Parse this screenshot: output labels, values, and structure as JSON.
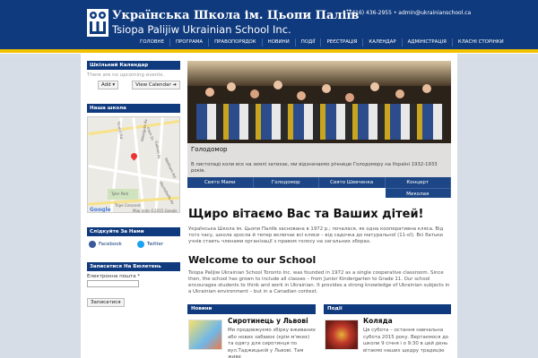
{
  "header": {
    "title_ua": "Українська Школа ім. Цьопи Паліїв",
    "title_en": "Tsiopa Palijiw Ukrainian School Inc.",
    "contact": "(416) 436-2955 • admin@ukrainianschool.ca",
    "nav": [
      "ГОЛОВНЕ",
      "ПРОГРАМА",
      "ПРАВОПОРЯДОК",
      "НОВИНИ",
      "ПОДІЇ",
      "РЕЄСТРАЦІЯ",
      "КАЛЕНДАР",
      "АДМІНІСТРАЦІЯ",
      "КЛАСНІ СТОРІНКИ"
    ]
  },
  "sidebar": {
    "calendar": {
      "title": "Шкільний Календар",
      "empty": "There are no upcoming events.",
      "add": "Add",
      "view": "View Calendar"
    },
    "map": {
      "title": "Наша школа",
      "labels": [
        "Tindall Rd",
        "Westgate Av",
        "Irwin Dr",
        "Gabriel Av",
        "Waltham Rd",
        "Montebello Av",
        "Tyler Park",
        "Tripe Crescent"
      ],
      "copyright": "Map data ©2015 Google",
      "brand": "Google"
    },
    "social": {
      "title": "Слідкуйте За Нами",
      "facebook": "Facebook",
      "twitter": "Twitter"
    },
    "newsletter": {
      "title": "Записатися На Бюлетень",
      "email_label": "Електронна пошта *",
      "submit": "Записатися"
    }
  },
  "slider": {
    "caption_title": "Голодомор",
    "caption_text": "В листопаді коли все на землі затихає, ми відзначаємо річницю Голодомору на Україні 1932-1933 років.",
    "tabs": [
      "Свято Мами",
      "Голодомор",
      "Свято Шевченка",
      "Концерт",
      "Миколая"
    ]
  },
  "main": {
    "welcome_ua": "Щиро вітаємо Вас та Ваших дітей!",
    "intro_ua": "Українська Школа ім. Цьопи Паліїв заснована в 1972 р.; почалася, як одна кооперативна кляса. Від того часу, школа зросла й тепер включає всі кляси – від садочка до матуральної (11-ої). Всі батьки учнів ставть членами організації з правом голосу на загальних зборах.",
    "welcome_en": "Welcome to our School",
    "intro_en": "Tsiopa Palijiw Ukrainian School Toronto Inc. was founded in 1972 as a single cooperative classroom. Since then, the school has grown to include all classes – from Junior Kindergarten to Grade 11. Our school encourages students to think and work in Ukrainian. It provides a strong knowledge of Ukrainian subjects in a Ukrainian environment – but in a Canadian context."
  },
  "news": {
    "title": "Новини",
    "item_title": "Сиротинець у Львові",
    "item_text": "Ми продовжуємо збірку вживаних або нових забавок (крім м'яких) та одягу для сиротинця по вул.Таджицькій у Львові. Там живе"
  },
  "events": {
    "title": "Події",
    "item_title": "Коляда",
    "item_text": "Ця субота – остання навчальна субота 2015 року. Вертаємося до школи 9 січня і о 9:30 в цей день вітаємо наших щедру традицію"
  },
  "colors": {
    "primary": "#0f3a7e",
    "accent": "#f2c200"
  }
}
